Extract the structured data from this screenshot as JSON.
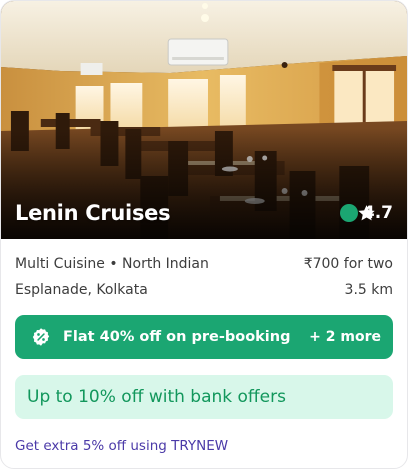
{
  "restaurant": {
    "name": "Lenin Cruises",
    "rating": "4.7",
    "cuisine": "Multi Cuisine • North Indian",
    "price": "₹700 for two",
    "location": "Esplanade, Kolkata",
    "distance": "3.5 km"
  },
  "offers": {
    "prebook_text": "Flat 40% off on pre-booking",
    "more_text": "+ 2 more",
    "bank_text": "Up to 10% off with bank offers",
    "promo_text": "Get extra 5% off using TRYNEW"
  },
  "colors": {
    "green": "#1ba672",
    "light_green": "#d8f7ea",
    "bank_text": "#12975c",
    "promo_purple": "#4b3aa8"
  },
  "icons": {
    "rating": "star-icon",
    "offer": "percent-badge-icon"
  }
}
